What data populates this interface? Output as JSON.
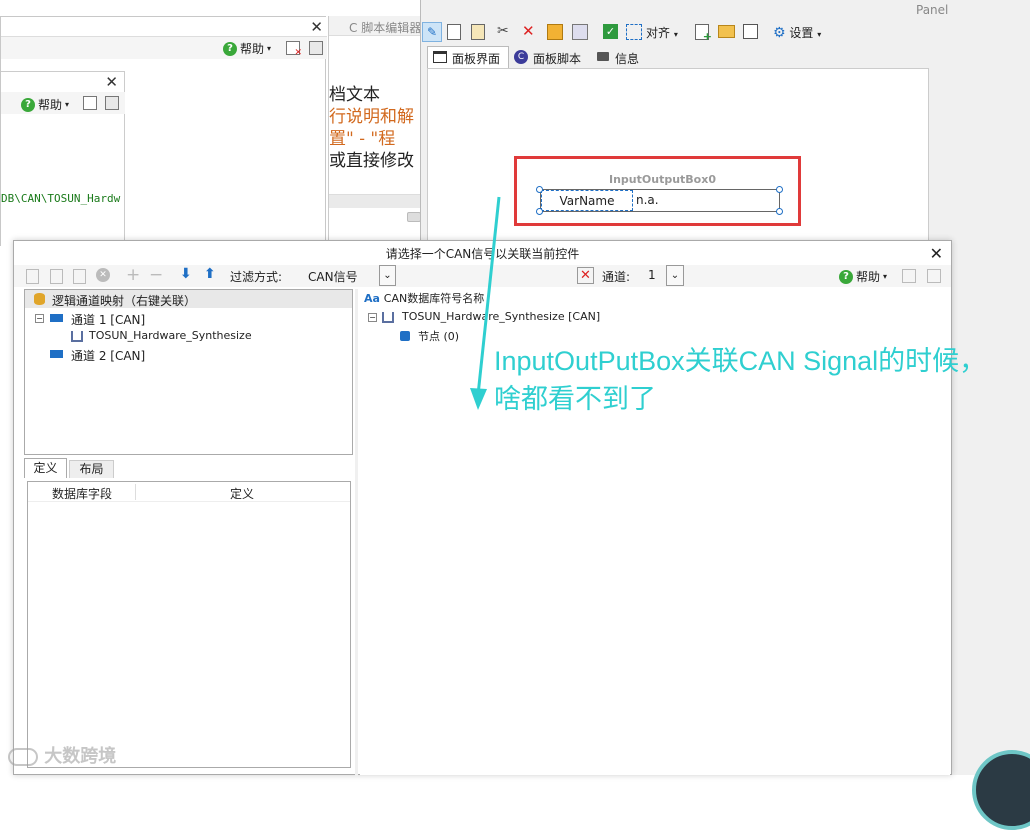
{
  "win_left": {
    "help_label": "帮助",
    "inner_help_label": "帮助",
    "path_text": "DB\\CAN\\TOSUN_Hardw"
  },
  "script_editor": {
    "tab_title": "C 脚本编辑器",
    "lines": [
      "档文本",
      "行说明和解",
      "置\" - \"程",
      "或直接修改"
    ]
  },
  "panel": {
    "title": "Panel",
    "align_label": "对齐",
    "settings_label": "设置",
    "tabs": [
      {
        "label": "面板界面"
      },
      {
        "label": "面板脚本"
      },
      {
        "label": "信息"
      }
    ],
    "control": {
      "title": "InputOutputBox0",
      "var_label": "VarName",
      "value": "n.a."
    }
  },
  "dialog": {
    "title": "请选择一个CAN信号以关联当前控件",
    "filter_label": "过滤方式:",
    "filter_value": "CAN信号",
    "channel_label": "通道:",
    "channel_value": "1",
    "help_label": "帮助",
    "tree_root": "逻辑通道映射（右键关联）",
    "tree_items": [
      {
        "label": "通道 1 [CAN]"
      },
      {
        "label": "TOSUN_Hardware_Synthesize"
      },
      {
        "label": "通道 2 [CAN]"
      }
    ],
    "bottom_tabs": [
      {
        "label": "定义"
      },
      {
        "label": "布局"
      }
    ],
    "grid_headers": [
      "数据库字段",
      "定义"
    ],
    "right_header": "CAN数据库符号名称",
    "right_header_prefix": "Aa",
    "db_node": "TOSUN_Hardware_Synthesize [CAN]",
    "db_child": "节点 (0)"
  },
  "annotation": {
    "text": "InputOutPutBox关联CAN Signal的时候，啥都看不到了",
    "color": "#2fcfd0"
  },
  "watermark": "大数跨境",
  "colors": {
    "highlight_red": "#e03a3a",
    "accent_blue": "#1f6fc5",
    "cyan": "#2fcfd0"
  }
}
